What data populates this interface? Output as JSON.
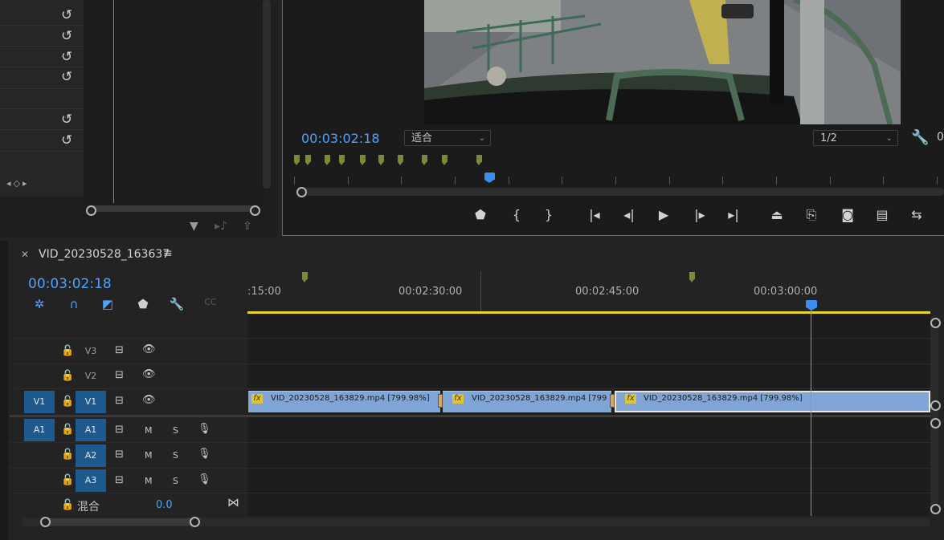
{
  "effect_controls": {
    "keyframe_nav": "◂◇▸",
    "icons": [
      "reset-icon",
      "filter-icon",
      "audio-output-icon",
      "export-icon"
    ]
  },
  "program_monitor": {
    "timecode": "00:03:02:18",
    "zoom_select": "适合",
    "quality_select": "1/2",
    "right_digit": "0",
    "controls": [
      "add-marker",
      "mark-in",
      "mark-out",
      "go-to-in",
      "step-back",
      "play",
      "step-forward",
      "go-to-out",
      "lift",
      "extract",
      "export-frame",
      "insert-overlay",
      "comparison-view"
    ]
  },
  "timeline": {
    "sequence_name": "VID_20230528_163637",
    "timecode": "00:03:02:18",
    "ruler_labels": [
      ":15:00",
      "00:02:30:00",
      "00:02:45:00",
      "00:03:00:00"
    ],
    "tracks": {
      "v3": {
        "label": "V3"
      },
      "v2": {
        "label": "V2"
      },
      "v1": {
        "label": "V1",
        "source": "V1"
      },
      "a1": {
        "label": "A1",
        "source": "A1",
        "m": "M",
        "s": "S"
      },
      "a2": {
        "label": "A2",
        "m": "M",
        "s": "S"
      },
      "a3": {
        "label": "A3",
        "m": "M",
        "s": "S"
      }
    },
    "mix": {
      "label": "混合",
      "value": "0.0"
    },
    "clips": [
      {
        "fx": "fx",
        "name": "VID_20230528_163829.mp4 [799.98%]"
      },
      {
        "fx": "fx",
        "name": "VID_20230528_163829.mp4 [799"
      },
      {
        "fx": "fx",
        "name": "VID_20230528_163829.mp4 [799.98%]"
      }
    ],
    "colors": {
      "accent": "#4da3ff",
      "clip": "#7ea5d6",
      "work_area": "#e6d428",
      "marker": "#7a8a3a"
    }
  }
}
